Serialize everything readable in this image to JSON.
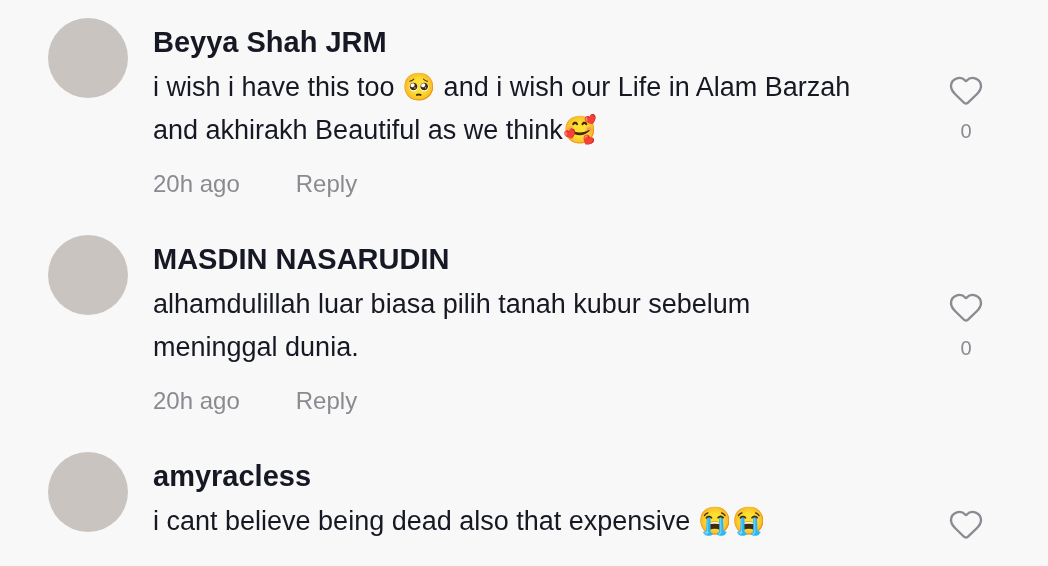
{
  "comments": [
    {
      "author": "Beyya Shah JRM",
      "text": "i wish i have this too 🥺 and i wish our Life in Alam Barzah and akhirakh Beautiful as we think🥰",
      "time": "20h ago",
      "reply": "Reply",
      "likes": "0"
    },
    {
      "author": "MASDIN NASARUDIN",
      "text": "alhamdulillah luar biasa pilih tanah kubur sebelum meninggal dunia.",
      "time": "20h ago",
      "reply": "Reply",
      "likes": "0"
    },
    {
      "author": "amyracless",
      "text": "i cant believe being dead also that expensive 😭😭"
    }
  ]
}
